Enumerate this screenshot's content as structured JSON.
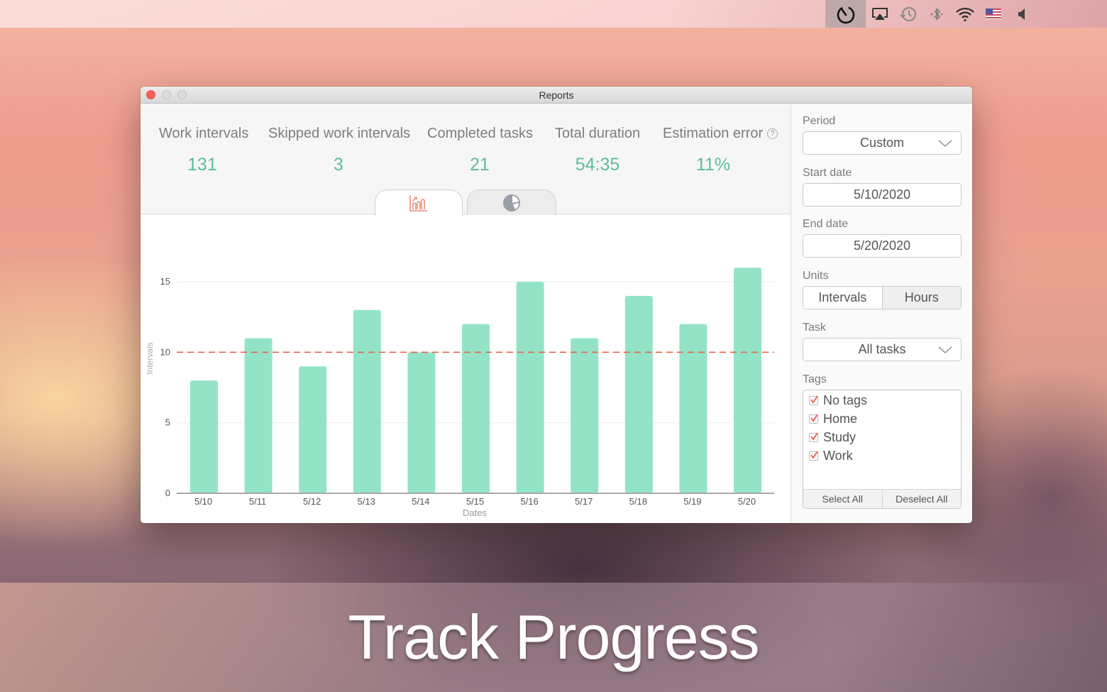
{
  "menubar": {
    "items": [
      {
        "icon": "timer-icon",
        "active": true
      },
      {
        "icon": "airplay-icon"
      },
      {
        "icon": "time-machine-icon"
      },
      {
        "icon": "bluetooth-icon"
      },
      {
        "icon": "wifi-icon"
      },
      {
        "icon": "us-flag-icon"
      },
      {
        "icon": "volume-icon"
      }
    ]
  },
  "window": {
    "title": "Reports"
  },
  "summary": {
    "stats": [
      {
        "label": "Work intervals",
        "value": "131"
      },
      {
        "label": "Skipped work intervals",
        "value": "3"
      },
      {
        "label": "Completed tasks",
        "value": "21"
      },
      {
        "label": "Total duration",
        "value": "54:35"
      },
      {
        "label": "Estimation error",
        "value": "11%",
        "help": "?"
      }
    ]
  },
  "tabs": [
    {
      "name": "bar-chart",
      "icon": "bar-chart-icon",
      "active": true
    },
    {
      "name": "pie-chart",
      "icon": "pie-chart-icon",
      "active": false
    }
  ],
  "sidebar": {
    "period_label": "Period",
    "period_value": "Custom",
    "start_label": "Start date",
    "start_value": "5/10/2020",
    "end_label": "End date",
    "end_value": "5/20/2020",
    "units_label": "Units",
    "units_options": [
      "Intervals",
      "Hours"
    ],
    "units_selected": "Intervals",
    "task_label": "Task",
    "task_value": "All tasks",
    "tags_label": "Tags",
    "tags": [
      {
        "label": "No tags",
        "checked": true
      },
      {
        "label": "Home",
        "checked": true
      },
      {
        "label": "Study",
        "checked": true
      },
      {
        "label": "Work",
        "checked": true
      }
    ],
    "select_all": "Select All",
    "deselect_all": "Deselect All"
  },
  "colors": {
    "bar": "#93e4c6",
    "goal_line": "#e5624c",
    "stat_value": "#5cbd9c",
    "accent_tab": "#ee8a78"
  },
  "chart_data": {
    "type": "bar",
    "title": "",
    "xlabel": "Dates",
    "ylabel": "Intervals",
    "categories": [
      "5/10",
      "5/11",
      "5/12",
      "5/13",
      "5/14",
      "5/15",
      "5/16",
      "5/17",
      "5/18",
      "5/19",
      "5/20"
    ],
    "values": [
      8,
      11,
      9,
      13,
      10,
      12,
      15,
      11,
      14,
      12,
      16
    ],
    "yticks": [
      0,
      5,
      10,
      15
    ],
    "ylim": [
      0,
      17
    ],
    "grid": true,
    "reference_line": {
      "value": 10,
      "style": "dashed",
      "color": "#e5624c"
    }
  },
  "caption": "Track Progress"
}
